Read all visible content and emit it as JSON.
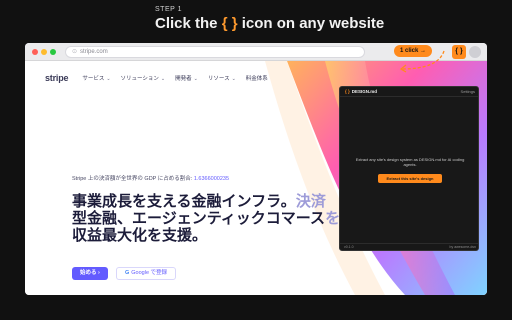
{
  "header": {
    "step": "STEP 1",
    "headline_pre": "Click the ",
    "headline_icon": "{ }",
    "headline_post": " icon on any website"
  },
  "browser": {
    "url": "stripe.com",
    "url_icon": "lock-icon",
    "click_badge": "1 click →",
    "extension_icon": "{ }"
  },
  "site": {
    "logo": "stripe",
    "nav": [
      {
        "label": "サービス"
      },
      {
        "label": "ソリューション"
      },
      {
        "label": "開発者"
      },
      {
        "label": "リソース"
      },
      {
        "label": "料金体系"
      }
    ],
    "tagline_pre": "Stripe 上の決済額が全世界の GDP に占める割合: ",
    "tagline_value": "1.6366000235",
    "hero_line1": "事業成長を支える金融インフラ。",
    "hero_line1_fade": "決済",
    "hero_line2": "型金融、エージェンティックコマース",
    "hero_line2_fade": "を",
    "hero_line3": "収益最大化を支援。",
    "cta_primary": "始める ›",
    "cta_secondary_icon": "G",
    "cta_secondary": "Google で登録"
  },
  "popup": {
    "title_icon": "{ }",
    "title": "DESIGN.md",
    "settings": "Settings",
    "description": "Extract any site's design system as DESIGN.md for AI coding agents.",
    "button": "Extract this site's design",
    "footer_left": "v0.1.0",
    "footer_right": "by awesome-dsn"
  },
  "colors": {
    "accent": "#ff8a1c",
    "brand": "#635bff",
    "background": "#111111"
  }
}
